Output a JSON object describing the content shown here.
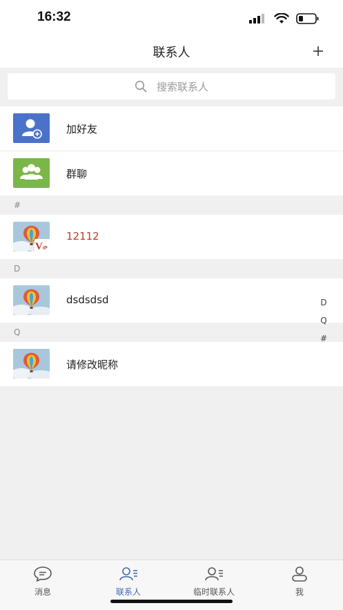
{
  "status_bar": {
    "time": "16:32"
  },
  "nav": {
    "title": "联系人",
    "add_icon": "plus-icon"
  },
  "search": {
    "placeholder": "搜索联系人"
  },
  "fixed_items": [
    {
      "label": "加好友",
      "icon": "add-friend-icon",
      "color": "#4a72c9"
    },
    {
      "label": "群聊",
      "icon": "group-icon",
      "color": "#7ab648"
    }
  ],
  "sections": [
    {
      "header": "#",
      "contacts": [
        {
          "name": "12112",
          "vip": true,
          "name_color": "#c0392b"
        }
      ]
    },
    {
      "header": "D",
      "contacts": [
        {
          "name": "dsdsdsd",
          "vip": false
        }
      ]
    },
    {
      "header": "Q",
      "contacts": [
        {
          "name": "请修改昵称",
          "vip": false
        }
      ]
    }
  ],
  "index_bar": [
    "D",
    "Q",
    "#"
  ],
  "tabs": [
    {
      "label": "消息",
      "icon": "chat-bubble-icon",
      "active": false
    },
    {
      "label": "联系人",
      "icon": "contacts-icon",
      "active": true
    },
    {
      "label": "临时联系人",
      "icon": "temp-contacts-icon",
      "active": false
    },
    {
      "label": "我",
      "icon": "profile-icon",
      "active": false
    }
  ],
  "colors": {
    "active_tab": "#3c68b3",
    "inactive_tab": "#555555",
    "vip_badge": "#c0392b"
  }
}
